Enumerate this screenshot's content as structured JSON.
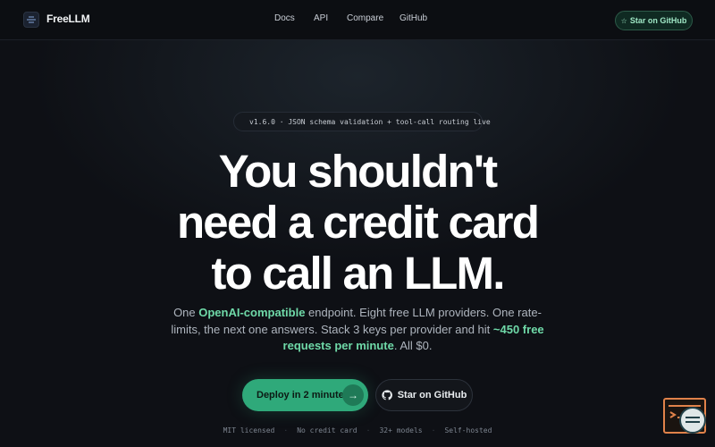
{
  "brand": {
    "name": "FreeLLM"
  },
  "nav": {
    "links": [
      "Docs",
      "API",
      "Compare",
      "GitHub"
    ],
    "star_label": "Star on GitHub",
    "star_icon": "star-icon"
  },
  "badge": {
    "text": "v1.6.0 · JSON schema validation + tool-call routing live"
  },
  "hero": {
    "headline_line1": "You shouldn't",
    "headline_line2": "need a credit card",
    "headline_line3": "to call an LLM.",
    "sub_part1": "One ",
    "sub_hl1": "OpenAI-compatible",
    "sub_part2": " endpoint. Eight free LLM providers. One rate-limits, the next one answers. Stack 3 keys per provider and hit ",
    "sub_hl2": "~450 free requests per minute",
    "sub_part3": ". All $0."
  },
  "cta": {
    "primary_label": "Deploy in 2 minutes",
    "secondary_label": "Star on GitHub"
  },
  "features": [
    "MIT licensed",
    "No credit card",
    "32+ models",
    "Self-hosted"
  ],
  "colors": {
    "accent": "#2fa97a",
    "accent_text": "#6fd9a8",
    "background": "#0e1015"
  }
}
